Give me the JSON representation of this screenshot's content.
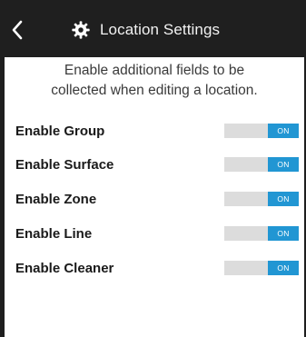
{
  "header": {
    "back_icon": "chevron-left-icon",
    "title_icon": "gear-icon",
    "title": "Location Settings"
  },
  "intro": {
    "line1": "Enable additional fields to be",
    "line2": "collected when editing a location."
  },
  "settings": [
    {
      "label": "Enable Group",
      "state": "ON"
    },
    {
      "label": "Enable Surface",
      "state": "ON"
    },
    {
      "label": "Enable Zone",
      "state": "ON"
    },
    {
      "label": "Enable Line",
      "state": "ON"
    },
    {
      "label": "Enable Cleaner",
      "state": "ON"
    }
  ],
  "colors": {
    "header_bg": "#1f1f1f",
    "toggle_on": "#2196d3",
    "toggle_track": "#dcdcdc"
  }
}
